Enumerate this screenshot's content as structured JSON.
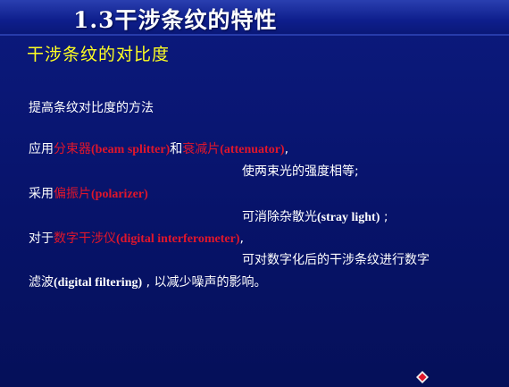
{
  "header": {
    "title": "1.3干涉条纹的特性"
  },
  "slide": {
    "subtitle": "干涉条纹的对比度",
    "intro": "提高条纹对比度的方法",
    "line1": {
      "prefix": "应用",
      "term1_cn": "分束器",
      "term1_en": "(beam splitter)",
      "joiner": "和",
      "term2_cn": "衰减片",
      "term2_en": "(attenuator)",
      "suffix": ","
    },
    "line2": "使两束光的强度相等;",
    "line3": {
      "prefix": "采用",
      "term_cn": "偏振片",
      "term_en": "(polarizer)"
    },
    "line4": {
      "text": "可消除杂散光",
      "en": "(stray light)",
      "suffix": " ;"
    },
    "line5": {
      "prefix": "对于",
      "term_cn": "数字干涉仪",
      "term_en": "(digital interferometer)",
      "suffix": ","
    },
    "line6": "可对数字化后的干涉条纹进行数字",
    "line7": {
      "prefix": "滤波",
      "en": "(digital filtering)",
      "suffix": " , 以减少噪声的影响。"
    }
  },
  "nav": {
    "icon": "diamond-nav-icon",
    "colors": {
      "fill": "#e0162b",
      "ring": "#f0f0f0"
    }
  }
}
